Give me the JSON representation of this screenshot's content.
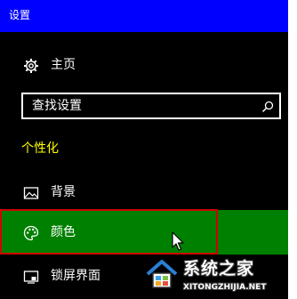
{
  "window": {
    "title": "设置"
  },
  "nav": {
    "home": {
      "label": "主页",
      "icon": "gear-icon"
    }
  },
  "search": {
    "placeholder": "查找设置",
    "icon": "search-icon"
  },
  "section": {
    "heading": "个性化",
    "items": [
      {
        "label": "背景",
        "icon": "picture-icon",
        "selected": false
      },
      {
        "label": "颜色",
        "icon": "palette-icon",
        "selected": true
      },
      {
        "label": "锁屏界面",
        "icon": "lock-screen-icon",
        "selected": false
      }
    ]
  },
  "watermark": {
    "title": "系统之家",
    "url": "XITONGZHIJIA.NET"
  },
  "colors": {
    "titlebar": "#0000ff",
    "background": "#000000",
    "heading": "#ffff00",
    "selected": "#008000",
    "highlight_border": "#d00000",
    "text": "#ffffff"
  }
}
